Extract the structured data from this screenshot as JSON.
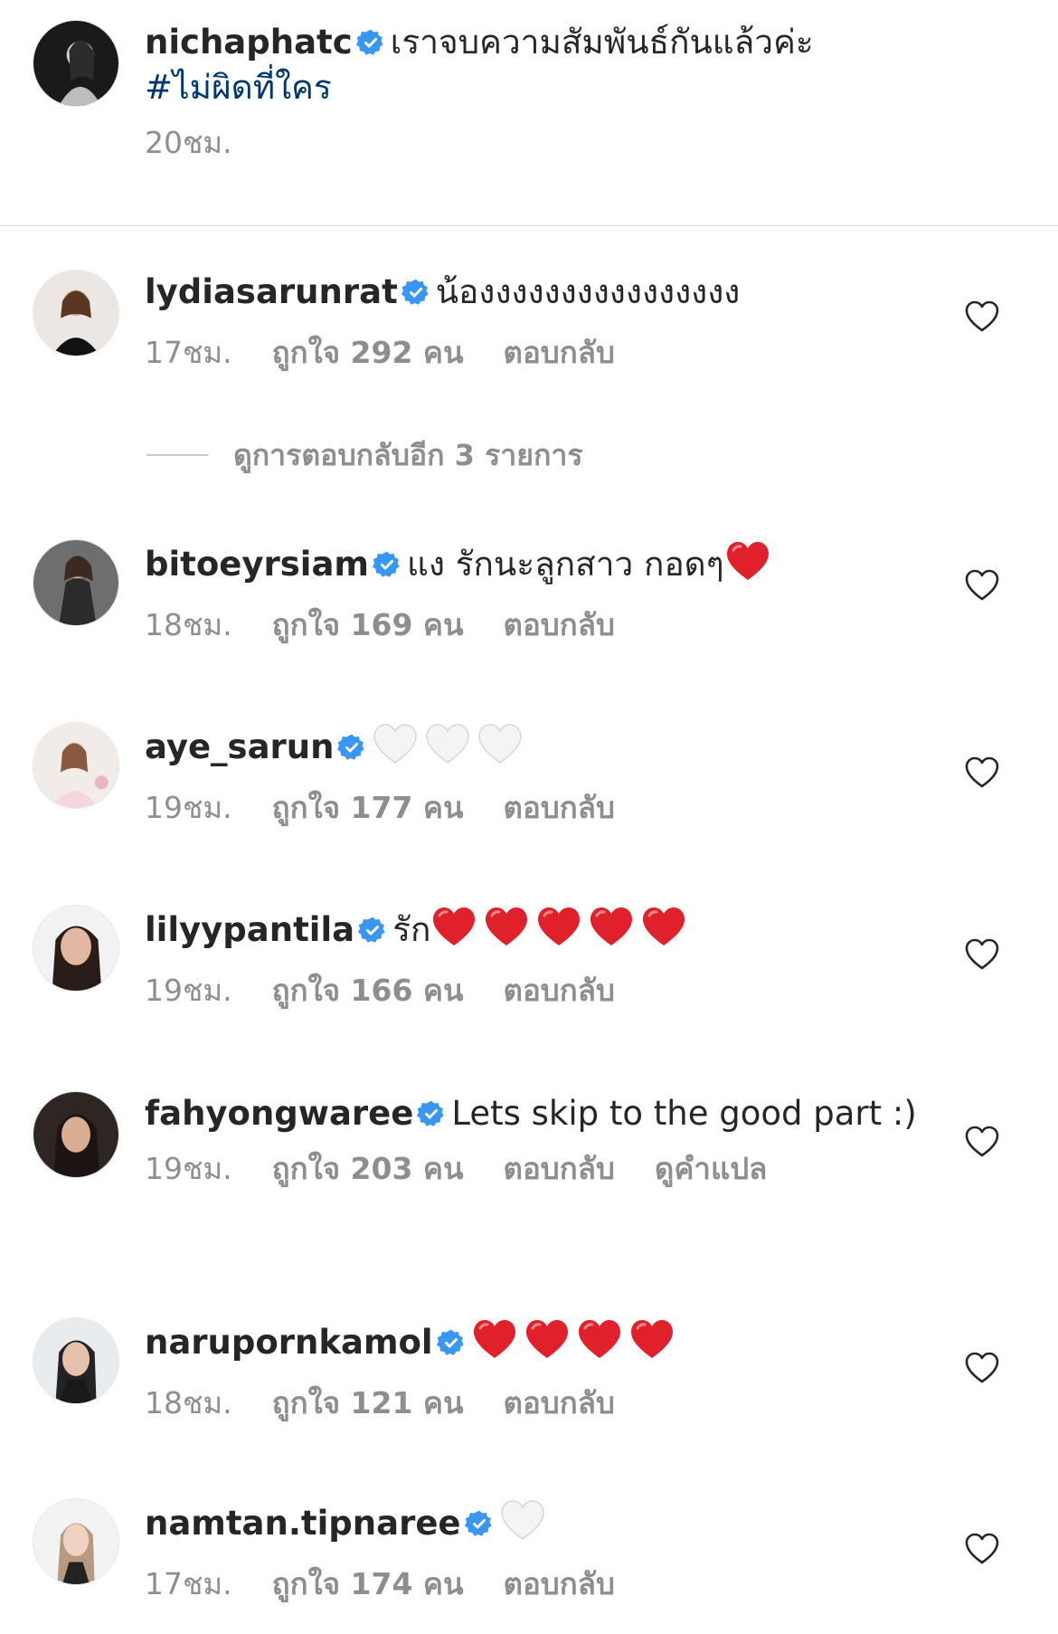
{
  "post": {
    "username": "nichaphatc",
    "caption": "เราจบความสัมพันธ์กันแล้วค่ะ",
    "hashtag": "#ไม่ผิดที่ใคร",
    "time": "20ชม."
  },
  "more_replies": "ดูการตอบกลับอีก 3 รายการ",
  "comments": [
    {
      "username": "lydiasarunrat",
      "text": "น้องงงงงงงงงงงงงงงง",
      "time": "17ชม.",
      "likes": "ถูกใจ 292 คน",
      "reply": "ตอบกลับ"
    },
    {
      "username": "bitoeyrsiam",
      "text": "แง รักนะลูกสาว กอดๆ",
      "time": "18ชม.",
      "likes": "ถูกใจ 169 คน",
      "reply": "ตอบกลับ"
    },
    {
      "username": "aye_sarun",
      "text": "",
      "time": "19ชม.",
      "likes": "ถูกใจ 177 คน",
      "reply": "ตอบกลับ"
    },
    {
      "username": "lilyypantila",
      "text": "รัก",
      "time": "19ชม.",
      "likes": "ถูกใจ 166 คน",
      "reply": "ตอบกลับ"
    },
    {
      "username": "fahyongwaree",
      "text": "Lets skip to the good part :)",
      "time": "19ชม.",
      "likes": "ถูกใจ 203 คน",
      "reply": "ตอบกลับ",
      "translate": "ดูคำแปล"
    },
    {
      "username": "narupornkamol",
      "text": "",
      "time": "18ชม.",
      "likes": "ถูกใจ 121 คน",
      "reply": "ตอบกลับ"
    },
    {
      "username": "namtan.tipnaree",
      "text": "",
      "time": "17ชม.",
      "likes": "ถูกใจ 174 คน",
      "reply": "ตอบกลับ"
    }
  ],
  "emojis": {
    "red_heart": "red-heart-emoji",
    "white_heart": "white-heart-emoji"
  },
  "colors": {
    "verified_badge": "#3897f0",
    "hashtag": "#00376b",
    "meta_text": "#8e8e8e",
    "red_heart": "#e0202a"
  }
}
